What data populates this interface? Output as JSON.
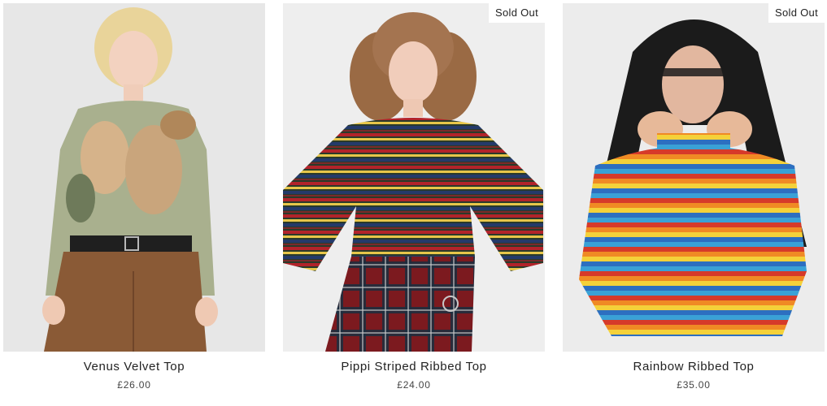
{
  "products": [
    {
      "name": "Venus Velvet Top",
      "price": "£26.00",
      "badge": ""
    },
    {
      "name": "Pippi Striped Ribbed Top",
      "price": "£24.00",
      "badge": "Sold Out"
    },
    {
      "name": "Rainbow Ribbed Top",
      "price": "£35.00",
      "badge": "Sold Out"
    }
  ],
  "colors": {
    "background": "#ffffff",
    "text": "#222222",
    "badge_background": "#ffffff"
  }
}
